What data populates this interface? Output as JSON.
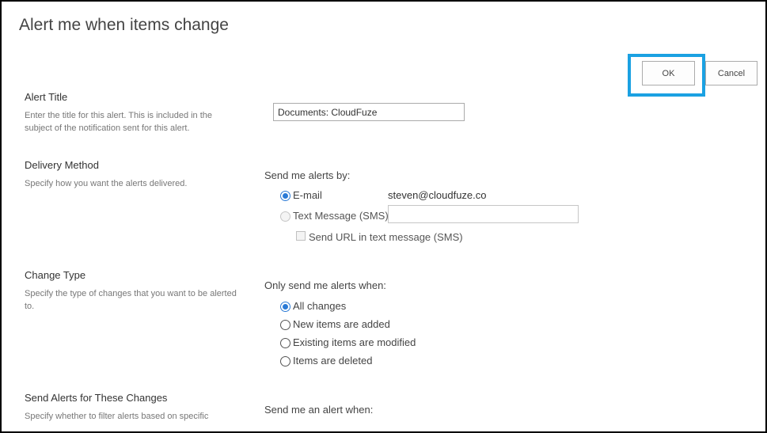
{
  "dialog": {
    "title": "Alert me when items change"
  },
  "buttons": {
    "ok": "OK",
    "cancel": "Cancel"
  },
  "colors": {
    "highlight": "#1ba1e2",
    "radio_selected": "#2a7ad6"
  },
  "alert_title": {
    "heading": "Alert Title",
    "description": "Enter the title for this alert. This is included in the subject of the notification sent for this alert.",
    "value": "Documents: CloudFuze"
  },
  "delivery_method": {
    "heading": "Delivery Method",
    "description": "Specify how you want the alerts delivered.",
    "prompt": "Send me alerts by:",
    "options": [
      {
        "label": "E-mail",
        "selected": true,
        "enabled": true
      },
      {
        "label": "Text Message (SMS)",
        "selected": false,
        "enabled": false
      }
    ],
    "email_value": "steven@cloudfuze.co",
    "sms_value": "",
    "send_url_label": "Send URL in text message (SMS)",
    "send_url_checked": false
  },
  "change_type": {
    "heading": "Change Type",
    "description": "Specify the type of changes that you want to be alerted to.",
    "prompt": "Only send me alerts when:",
    "options": [
      {
        "label": "All changes",
        "selected": true
      },
      {
        "label": "New items are added",
        "selected": false
      },
      {
        "label": "Existing items are modified",
        "selected": false
      },
      {
        "label": "Items are deleted",
        "selected": false
      }
    ]
  },
  "send_alerts": {
    "heading": "Send Alerts for These Changes",
    "description": "Specify whether to filter alerts based on specific",
    "prompt": "Send me an alert when:"
  }
}
